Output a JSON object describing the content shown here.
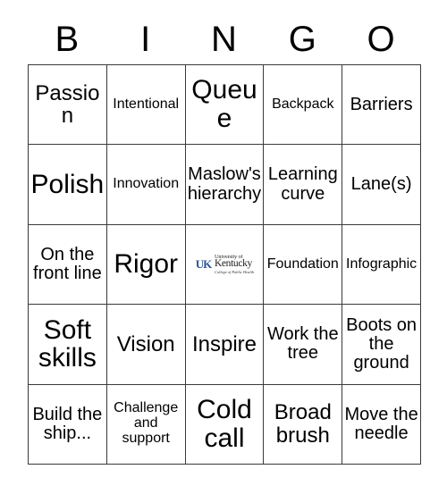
{
  "card": {
    "title": "BINGO",
    "header_letters": [
      "B",
      "I",
      "N",
      "G",
      "O"
    ],
    "logo": {
      "mark_text": "UK",
      "line1": "University of",
      "line2": "Kentucky",
      "line3": "College of Public Health",
      "mark_color": "#2f5596",
      "alt": "University of Kentucky College of Public Health logo"
    },
    "colors": {
      "background": "#ffffff",
      "text": "#000000",
      "grid_line": "#3a3a3a",
      "logo_blue": "#2f5596"
    },
    "rows": [
      [
        {
          "text": "Passion",
          "size": "fs-lg"
        },
        {
          "text": "Intentional",
          "size": "fs-sm"
        },
        {
          "text": "Queue",
          "size": "fs-xl"
        },
        {
          "text": "Backpack",
          "size": "fs-sm"
        },
        {
          "text": "Barriers",
          "size": "fs-md"
        }
      ],
      [
        {
          "text": "Polish",
          "size": "fs-xl"
        },
        {
          "text": "Innovation",
          "size": "fs-sm"
        },
        {
          "text": "Maslow's hierarchy",
          "size": "fs-md"
        },
        {
          "text": "Learning curve",
          "size": "fs-md"
        },
        {
          "text": "Lane(s)",
          "size": "fs-md"
        }
      ],
      [
        {
          "text": "On the front line",
          "size": "fs-md"
        },
        {
          "text": "Rigor",
          "size": "fs-xl"
        },
        {
          "text": "",
          "size": "logo"
        },
        {
          "text": "Foundation",
          "size": "fs-sm"
        },
        {
          "text": "Infographic",
          "size": "fs-sm"
        }
      ],
      [
        {
          "text": "Soft skills",
          "size": "fs-xl"
        },
        {
          "text": "Vision",
          "size": "fs-lg"
        },
        {
          "text": "Inspire",
          "size": "fs-lg"
        },
        {
          "text": "Work the tree",
          "size": "fs-md"
        },
        {
          "text": "Boots on the ground",
          "size": "fs-md"
        }
      ],
      [
        {
          "text": "Build the ship...",
          "size": "fs-md"
        },
        {
          "text": "Challenge and support",
          "size": "fs-sm"
        },
        {
          "text": "Cold call",
          "size": "fs-xl"
        },
        {
          "text": "Broad brush",
          "size": "fs-lg"
        },
        {
          "text": "Move the needle",
          "size": "fs-md"
        }
      ]
    ]
  }
}
